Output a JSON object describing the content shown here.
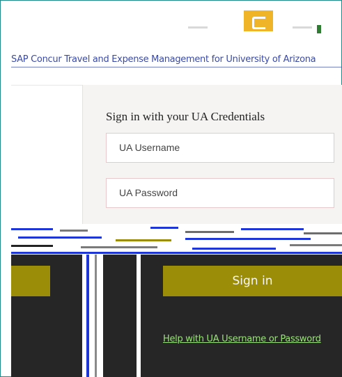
{
  "header": {
    "logo_icon": "app-logo-icon",
    "app_title": "SAP Concur Travel and Expense Management for University of Arizona",
    "accent_color": "#f0b429"
  },
  "login": {
    "heading": "Sign in with your UA Credentials",
    "username_placeholder": "UA Username",
    "password_placeholder": "UA Password",
    "signin_label": "Sign in",
    "help_link": "Help with UA Username or Password",
    "button_color": "#9b8d07",
    "link_color": "#9be37a"
  }
}
